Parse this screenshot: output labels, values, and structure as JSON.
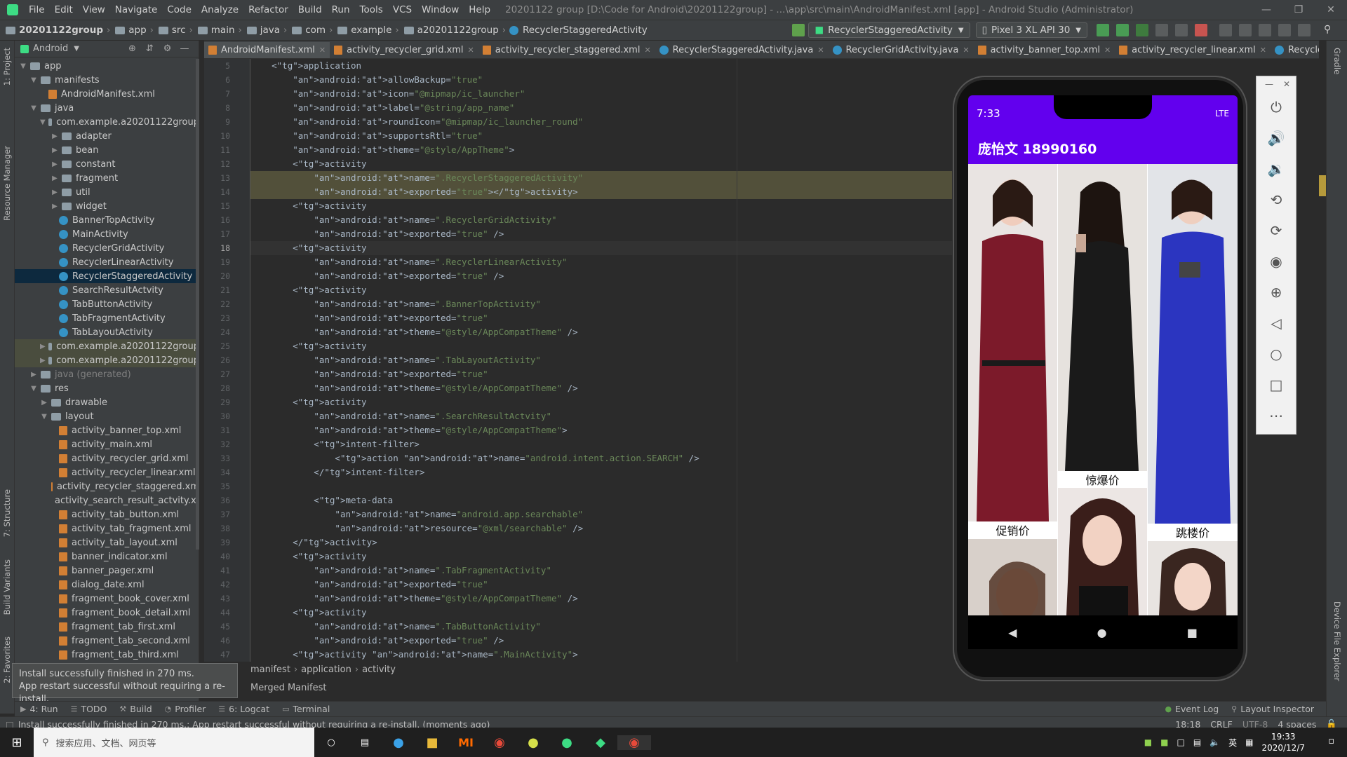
{
  "menubar": {
    "items": [
      "File",
      "Edit",
      "View",
      "Navigate",
      "Code",
      "Analyze",
      "Refactor",
      "Build",
      "Run",
      "Tools",
      "VCS",
      "Window",
      "Help"
    ],
    "title": "20201122 group [D:\\Code for Android\\20201122group] - ...\\app\\src\\main\\AndroidManifest.xml [app] - Android Studio (Administrator)"
  },
  "navbar": {
    "crumbs": [
      "20201122group",
      "app",
      "src",
      "main",
      "java",
      "com",
      "example",
      "a20201122group",
      "RecyclerStaggeredActivity"
    ],
    "run_config": "RecyclerStaggeredActivity",
    "device": "Pixel 3 XL API 30"
  },
  "project": {
    "view": "Android",
    "tree": [
      {
        "label": "app",
        "depth": 0,
        "icon": "folder",
        "arrow": "down"
      },
      {
        "label": "manifests",
        "depth": 1,
        "icon": "folder",
        "arrow": "down"
      },
      {
        "label": "AndroidManifest.xml",
        "depth": 2,
        "icon": "xml",
        "arrow": ""
      },
      {
        "label": "java",
        "depth": 1,
        "icon": "folder",
        "arrow": "down"
      },
      {
        "label": "com.example.a20201122group",
        "depth": 2,
        "icon": "pkg",
        "arrow": "down"
      },
      {
        "label": "adapter",
        "depth": 3,
        "icon": "pkg",
        "arrow": "right"
      },
      {
        "label": "bean",
        "depth": 3,
        "icon": "pkg",
        "arrow": "right"
      },
      {
        "label": "constant",
        "depth": 3,
        "icon": "pkg",
        "arrow": "right"
      },
      {
        "label": "fragment",
        "depth": 3,
        "icon": "pkg",
        "arrow": "right"
      },
      {
        "label": "util",
        "depth": 3,
        "icon": "pkg",
        "arrow": "right"
      },
      {
        "label": "widget",
        "depth": 3,
        "icon": "pkg",
        "arrow": "right"
      },
      {
        "label": "BannerTopActivity",
        "depth": 3,
        "icon": "class",
        "arrow": ""
      },
      {
        "label": "MainActivity",
        "depth": 3,
        "icon": "class",
        "arrow": ""
      },
      {
        "label": "RecyclerGridActivity",
        "depth": 3,
        "icon": "class",
        "arrow": ""
      },
      {
        "label": "RecyclerLinearActivity",
        "depth": 3,
        "icon": "class",
        "arrow": ""
      },
      {
        "label": "RecyclerStaggeredActivity",
        "depth": 3,
        "icon": "class",
        "arrow": "",
        "selected": true
      },
      {
        "label": "SearchResultActvity",
        "depth": 3,
        "icon": "class",
        "arrow": ""
      },
      {
        "label": "TabButtonActivity",
        "depth": 3,
        "icon": "class",
        "arrow": ""
      },
      {
        "label": "TabFragmentActivity",
        "depth": 3,
        "icon": "class",
        "arrow": ""
      },
      {
        "label": "TabLayoutActivity",
        "depth": 3,
        "icon": "class",
        "arrow": ""
      },
      {
        "label": "com.example.a20201122group",
        "depth": 2,
        "icon": "pkg",
        "arrow": "right",
        "hl": true
      },
      {
        "label": "com.example.a20201122group",
        "depth": 2,
        "icon": "pkg",
        "arrow": "right",
        "hl": true
      },
      {
        "label": "java (generated)",
        "depth": 1,
        "icon": "folder",
        "arrow": "right"
      },
      {
        "label": "res",
        "depth": 1,
        "icon": "folder",
        "arrow": "down"
      },
      {
        "label": "drawable",
        "depth": 2,
        "icon": "folder",
        "arrow": "right"
      },
      {
        "label": "layout",
        "depth": 2,
        "icon": "folder",
        "arrow": "down"
      },
      {
        "label": "activity_banner_top.xml",
        "depth": 3,
        "icon": "xml",
        "arrow": ""
      },
      {
        "label": "activity_main.xml",
        "depth": 3,
        "icon": "xml",
        "arrow": ""
      },
      {
        "label": "activity_recycler_grid.xml",
        "depth": 3,
        "icon": "xml",
        "arrow": ""
      },
      {
        "label": "activity_recycler_linear.xml",
        "depth": 3,
        "icon": "xml",
        "arrow": ""
      },
      {
        "label": "activity_recycler_staggered.xm",
        "depth": 3,
        "icon": "xml",
        "arrow": ""
      },
      {
        "label": "activity_search_result_actvity.xr",
        "depth": 3,
        "icon": "xml",
        "arrow": ""
      },
      {
        "label": "activity_tab_button.xml",
        "depth": 3,
        "icon": "xml",
        "arrow": ""
      },
      {
        "label": "activity_tab_fragment.xml",
        "depth": 3,
        "icon": "xml",
        "arrow": ""
      },
      {
        "label": "activity_tab_layout.xml",
        "depth": 3,
        "icon": "xml",
        "arrow": ""
      },
      {
        "label": "banner_indicator.xml",
        "depth": 3,
        "icon": "xml",
        "arrow": ""
      },
      {
        "label": "banner_pager.xml",
        "depth": 3,
        "icon": "xml",
        "arrow": ""
      },
      {
        "label": "dialog_date.xml",
        "depth": 3,
        "icon": "xml",
        "arrow": ""
      },
      {
        "label": "fragment_book_cover.xml",
        "depth": 3,
        "icon": "xml",
        "arrow": ""
      },
      {
        "label": "fragment_book_detail.xml",
        "depth": 3,
        "icon": "xml",
        "arrow": ""
      },
      {
        "label": "fragment_tab_first.xml",
        "depth": 3,
        "icon": "xml",
        "arrow": ""
      },
      {
        "label": "fragment_tab_second.xml",
        "depth": 3,
        "icon": "xml",
        "arrow": ""
      },
      {
        "label": "fragment_tab_third.xml",
        "depth": 3,
        "icon": "xml",
        "arrow": ""
      }
    ]
  },
  "tabs": [
    "AndroidManifest.xml",
    "activity_recycler_grid.xml",
    "activity_recycler_staggered.xml",
    "RecyclerStaggeredActivity.java",
    "RecyclerGridActivity.java",
    "activity_banner_top.xml",
    "activity_recycler_linear.xml",
    "RecyclerLinearActivity.java"
  ],
  "code": [
    {
      "n": 5,
      "t": "    <application"
    },
    {
      "n": 6,
      "t": "        android:allowBackup=\"true\""
    },
    {
      "n": 7,
      "t": "        android:icon=\"@mipmap/ic_launcher\""
    },
    {
      "n": 8,
      "t": "        android:label=\"@string/app_name\""
    },
    {
      "n": 9,
      "t": "        android:roundIcon=\"@mipmap/ic_launcher_round\""
    },
    {
      "n": 10,
      "t": "        android:supportsRtl=\"true\""
    },
    {
      "n": 11,
      "t": "        android:theme=\"@style/AppTheme\">"
    },
    {
      "n": 12,
      "t": "        <activity"
    },
    {
      "n": 13,
      "t": "            android:name=\".RecyclerStaggeredActivity\"",
      "hl": true
    },
    {
      "n": 14,
      "t": "            android:exported=\"true\"></activity>",
      "hl": true
    },
    {
      "n": 15,
      "t": "        <activity"
    },
    {
      "n": 16,
      "t": "            android:name=\".RecyclerGridActivity\""
    },
    {
      "n": 17,
      "t": "            android:exported=\"true\" />"
    },
    {
      "n": 18,
      "t": "        <activity",
      "cur": true
    },
    {
      "n": 19,
      "t": "            android:name=\".RecyclerLinearActivity\""
    },
    {
      "n": 20,
      "t": "            android:exported=\"true\" />"
    },
    {
      "n": 21,
      "t": "        <activity"
    },
    {
      "n": 22,
      "t": "            android:name=\".BannerTopActivity\""
    },
    {
      "n": 23,
      "t": "            android:exported=\"true\""
    },
    {
      "n": 24,
      "t": "            android:theme=\"@style/AppCompatTheme\" />"
    },
    {
      "n": 25,
      "t": "        <activity"
    },
    {
      "n": 26,
      "t": "            android:name=\".TabLayoutActivity\""
    },
    {
      "n": 27,
      "t": "            android:exported=\"true\""
    },
    {
      "n": 28,
      "t": "            android:theme=\"@style/AppCompatTheme\" />"
    },
    {
      "n": 29,
      "t": "        <activity"
    },
    {
      "n": 30,
      "t": "            android:name=\".SearchResultActvity\""
    },
    {
      "n": 31,
      "t": "            android:theme=\"@style/AppCompatTheme\">"
    },
    {
      "n": 32,
      "t": "            <intent-filter>"
    },
    {
      "n": 33,
      "t": "                <action android:name=\"android.intent.action.SEARCH\" />"
    },
    {
      "n": 34,
      "t": "            </intent-filter>"
    },
    {
      "n": 35,
      "t": ""
    },
    {
      "n": 36,
      "t": "            <meta-data"
    },
    {
      "n": 37,
      "t": "                android:name=\"android.app.searchable\""
    },
    {
      "n": 38,
      "t": "                android:resource=\"@xml/searchable\" />"
    },
    {
      "n": 39,
      "t": "        </activity>"
    },
    {
      "n": 40,
      "t": "        <activity"
    },
    {
      "n": 41,
      "t": "            android:name=\".TabFragmentActivity\""
    },
    {
      "n": 42,
      "t": "            android:exported=\"true\""
    },
    {
      "n": 43,
      "t": "            android:theme=\"@style/AppCompatTheme\" />"
    },
    {
      "n": 44,
      "t": "        <activity"
    },
    {
      "n": 45,
      "t": "            android:name=\".TabButtonActivity\""
    },
    {
      "n": 46,
      "t": "            android:exported=\"true\" />"
    },
    {
      "n": 47,
      "t": "        <activity android:name=\".MainActivity\">"
    }
  ],
  "editor_breadcrumb": [
    "manifest",
    "application",
    "activity"
  ],
  "merged_manifest": "Merged Manifest",
  "tooltip": {
    "line1": "Install successfully finished in 270 ms.",
    "line2": "App restart successful without requiring a re-install."
  },
  "bottom_tools": [
    "4: Run",
    "TODO",
    "Build",
    "Profiler",
    "6: Logcat",
    "Terminal"
  ],
  "bottom_right": [
    "Event Log",
    "Layout Inspector"
  ],
  "status": {
    "message": "Install successfully finished in 270 ms.: App restart successful without requiring a re-install. (moments ago)",
    "position": "18:18",
    "line_sep": "CRLF",
    "encoding": "UTF-8",
    "indent": "4 spaces"
  },
  "left_stripe": [
    "1: Project",
    "Resource Manager",
    "7: Structure",
    "Build Variants",
    "2: Favorites"
  ],
  "right_stripe": [
    "Gradle",
    "Device File Explorer"
  ],
  "phone": {
    "time": "7:33",
    "signal": "LTE",
    "app_title": "庞怡文 18990160",
    "captions": [
      "促销价",
      "惊爆价",
      "跳楼价"
    ]
  },
  "taskbar": {
    "search_placeholder": "搜索应用、文档、网页等",
    "time": "19:33",
    "date": "2020/12/7",
    "ime": "英"
  },
  "colors": {
    "accent": "#6200ee",
    "selection": "#0d293e",
    "tab_underline": "#4a88c7"
  }
}
